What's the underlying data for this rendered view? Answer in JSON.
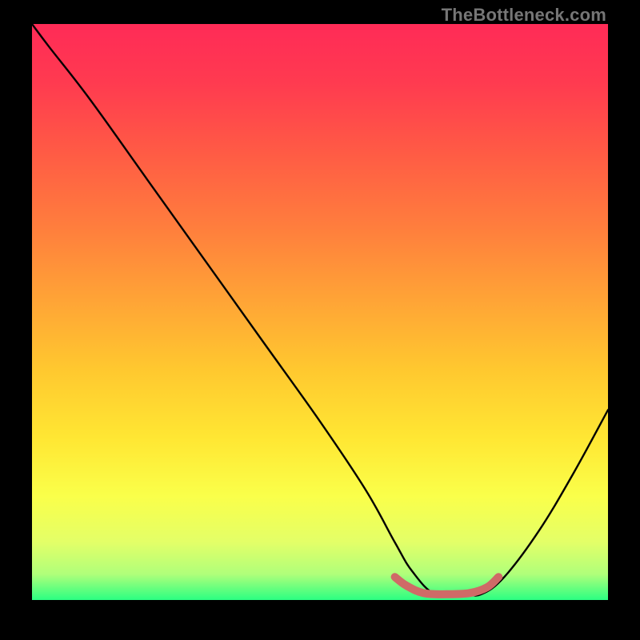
{
  "watermark": "TheBottleneck.com",
  "gradient": {
    "stops": [
      {
        "offset": 0.0,
        "color": "#ff2b57"
      },
      {
        "offset": 0.1,
        "color": "#ff3a50"
      },
      {
        "offset": 0.22,
        "color": "#ff5a45"
      },
      {
        "offset": 0.35,
        "color": "#ff7d3d"
      },
      {
        "offset": 0.48,
        "color": "#ffa436"
      },
      {
        "offset": 0.6,
        "color": "#ffc82f"
      },
      {
        "offset": 0.72,
        "color": "#ffe733"
      },
      {
        "offset": 0.82,
        "color": "#faff4a"
      },
      {
        "offset": 0.9,
        "color": "#e3ff68"
      },
      {
        "offset": 0.955,
        "color": "#b0ff7a"
      },
      {
        "offset": 1.0,
        "color": "#2bff82"
      }
    ]
  },
  "chart_data": {
    "type": "line",
    "title": "",
    "xlabel": "",
    "ylabel": "",
    "xlim": [
      0,
      100
    ],
    "ylim": [
      0,
      100
    ],
    "series": [
      {
        "name": "bottleneck-curve",
        "x": [
          0,
          3,
          10,
          20,
          30,
          40,
          50,
          58,
          63,
          66,
          70,
          75,
          78,
          82,
          88,
          94,
          100
        ],
        "y": [
          100,
          96,
          87,
          73,
          59,
          45,
          31,
          19,
          10,
          5,
          1,
          1,
          1,
          4,
          12,
          22,
          33
        ]
      }
    ],
    "highlight": {
      "name": "optimal-range",
      "color": "#cf6a67",
      "x": [
        63,
        65,
        68,
        72,
        76,
        79,
        81
      ],
      "y": [
        4,
        2.5,
        1.2,
        1.0,
        1.2,
        2.2,
        4
      ]
    }
  }
}
